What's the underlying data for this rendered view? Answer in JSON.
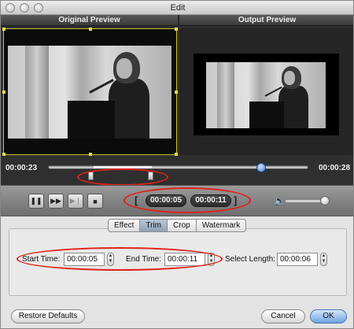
{
  "window": {
    "title": "Edit"
  },
  "preview": {
    "original_title": "Original Preview",
    "output_title": "Output Preview",
    "current_time": "00:00:23",
    "end_time": "00:00:28",
    "position_fraction": 0.82
  },
  "playback": {
    "buttons": [
      "pause-icon",
      "fast-forward-icon",
      "next-frame-icon",
      "stop-icon"
    ],
    "trim_start": "00:00:05",
    "trim_end": "00:00:11",
    "bracket_left": "[",
    "bracket_right": "]",
    "volume_icon": "speaker-icon"
  },
  "tabs": [
    {
      "label": "Effect",
      "active": false
    },
    {
      "label": "Trim",
      "active": true
    },
    {
      "label": "Crop",
      "active": false
    },
    {
      "label": "Watermark",
      "active": false
    }
  ],
  "trim": {
    "start_label": "Start Time:",
    "start_value": "00:00:05",
    "end_label": "End Time:",
    "end_value": "00:00:11",
    "length_label": "Select Length:",
    "length_value": "00:00:06"
  },
  "footer": {
    "restore_label": "Restore Defaults",
    "cancel_label": "Cancel",
    "ok_label": "OK"
  },
  "colors": {
    "annotation": "#e0211a",
    "accent": "#3e7bd6"
  }
}
